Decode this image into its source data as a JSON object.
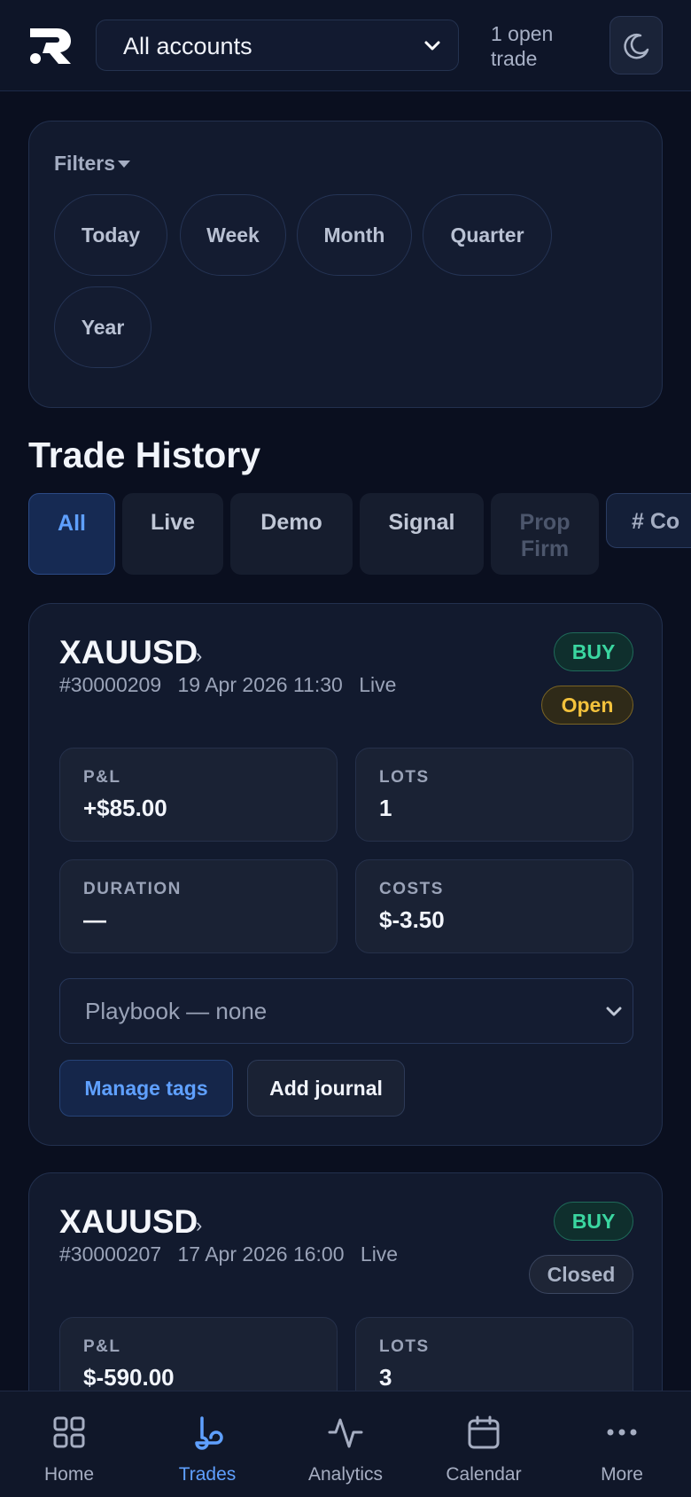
{
  "header": {
    "account_selector": "All accounts",
    "open_trades": "1 open trade",
    "theme_icon": "moon-icon"
  },
  "filters": {
    "title": "Filters",
    "chips": [
      "Today",
      "Week",
      "Month",
      "Quarter",
      "Year"
    ]
  },
  "trade_history": {
    "title": "Trade History",
    "tabs": [
      "All",
      "Live",
      "Demo",
      "Signal",
      "Prop Firm",
      "# Co"
    ],
    "active_tab": "All"
  },
  "trades": [
    {
      "symbol": "XAUUSD",
      "id": "#30000209",
      "datetime": "19 Apr 2026 11:30",
      "account_type": "Live",
      "side": "BUY",
      "status": "Open",
      "stats": {
        "pnl_label": "P&L",
        "pnl": "+$85.00",
        "lots_label": "LOTS",
        "lots": "1",
        "duration_label": "DURATION",
        "duration": "—",
        "costs_label": "COSTS",
        "costs": "$-3.50"
      },
      "playbook": "Playbook — none",
      "manage_tags": "Manage tags",
      "add_journal": "Add journal"
    },
    {
      "symbol": "XAUUSD",
      "id": "#30000207",
      "datetime": "17 Apr 2026 16:00",
      "account_type": "Live",
      "side": "BUY",
      "status": "Closed",
      "stats": {
        "pnl_label": "P&L",
        "pnl": "$-590.00",
        "lots_label": "LOTS",
        "lots": "3"
      }
    }
  ],
  "nav": {
    "items": [
      "Home",
      "Trades",
      "Analytics",
      "Calendar",
      "More"
    ],
    "active": "Trades"
  },
  "colors": {
    "background": "#0a0f1f",
    "accent": "#5fa0ff",
    "buy": "#3ad6a0",
    "open": "#f3c23c"
  }
}
